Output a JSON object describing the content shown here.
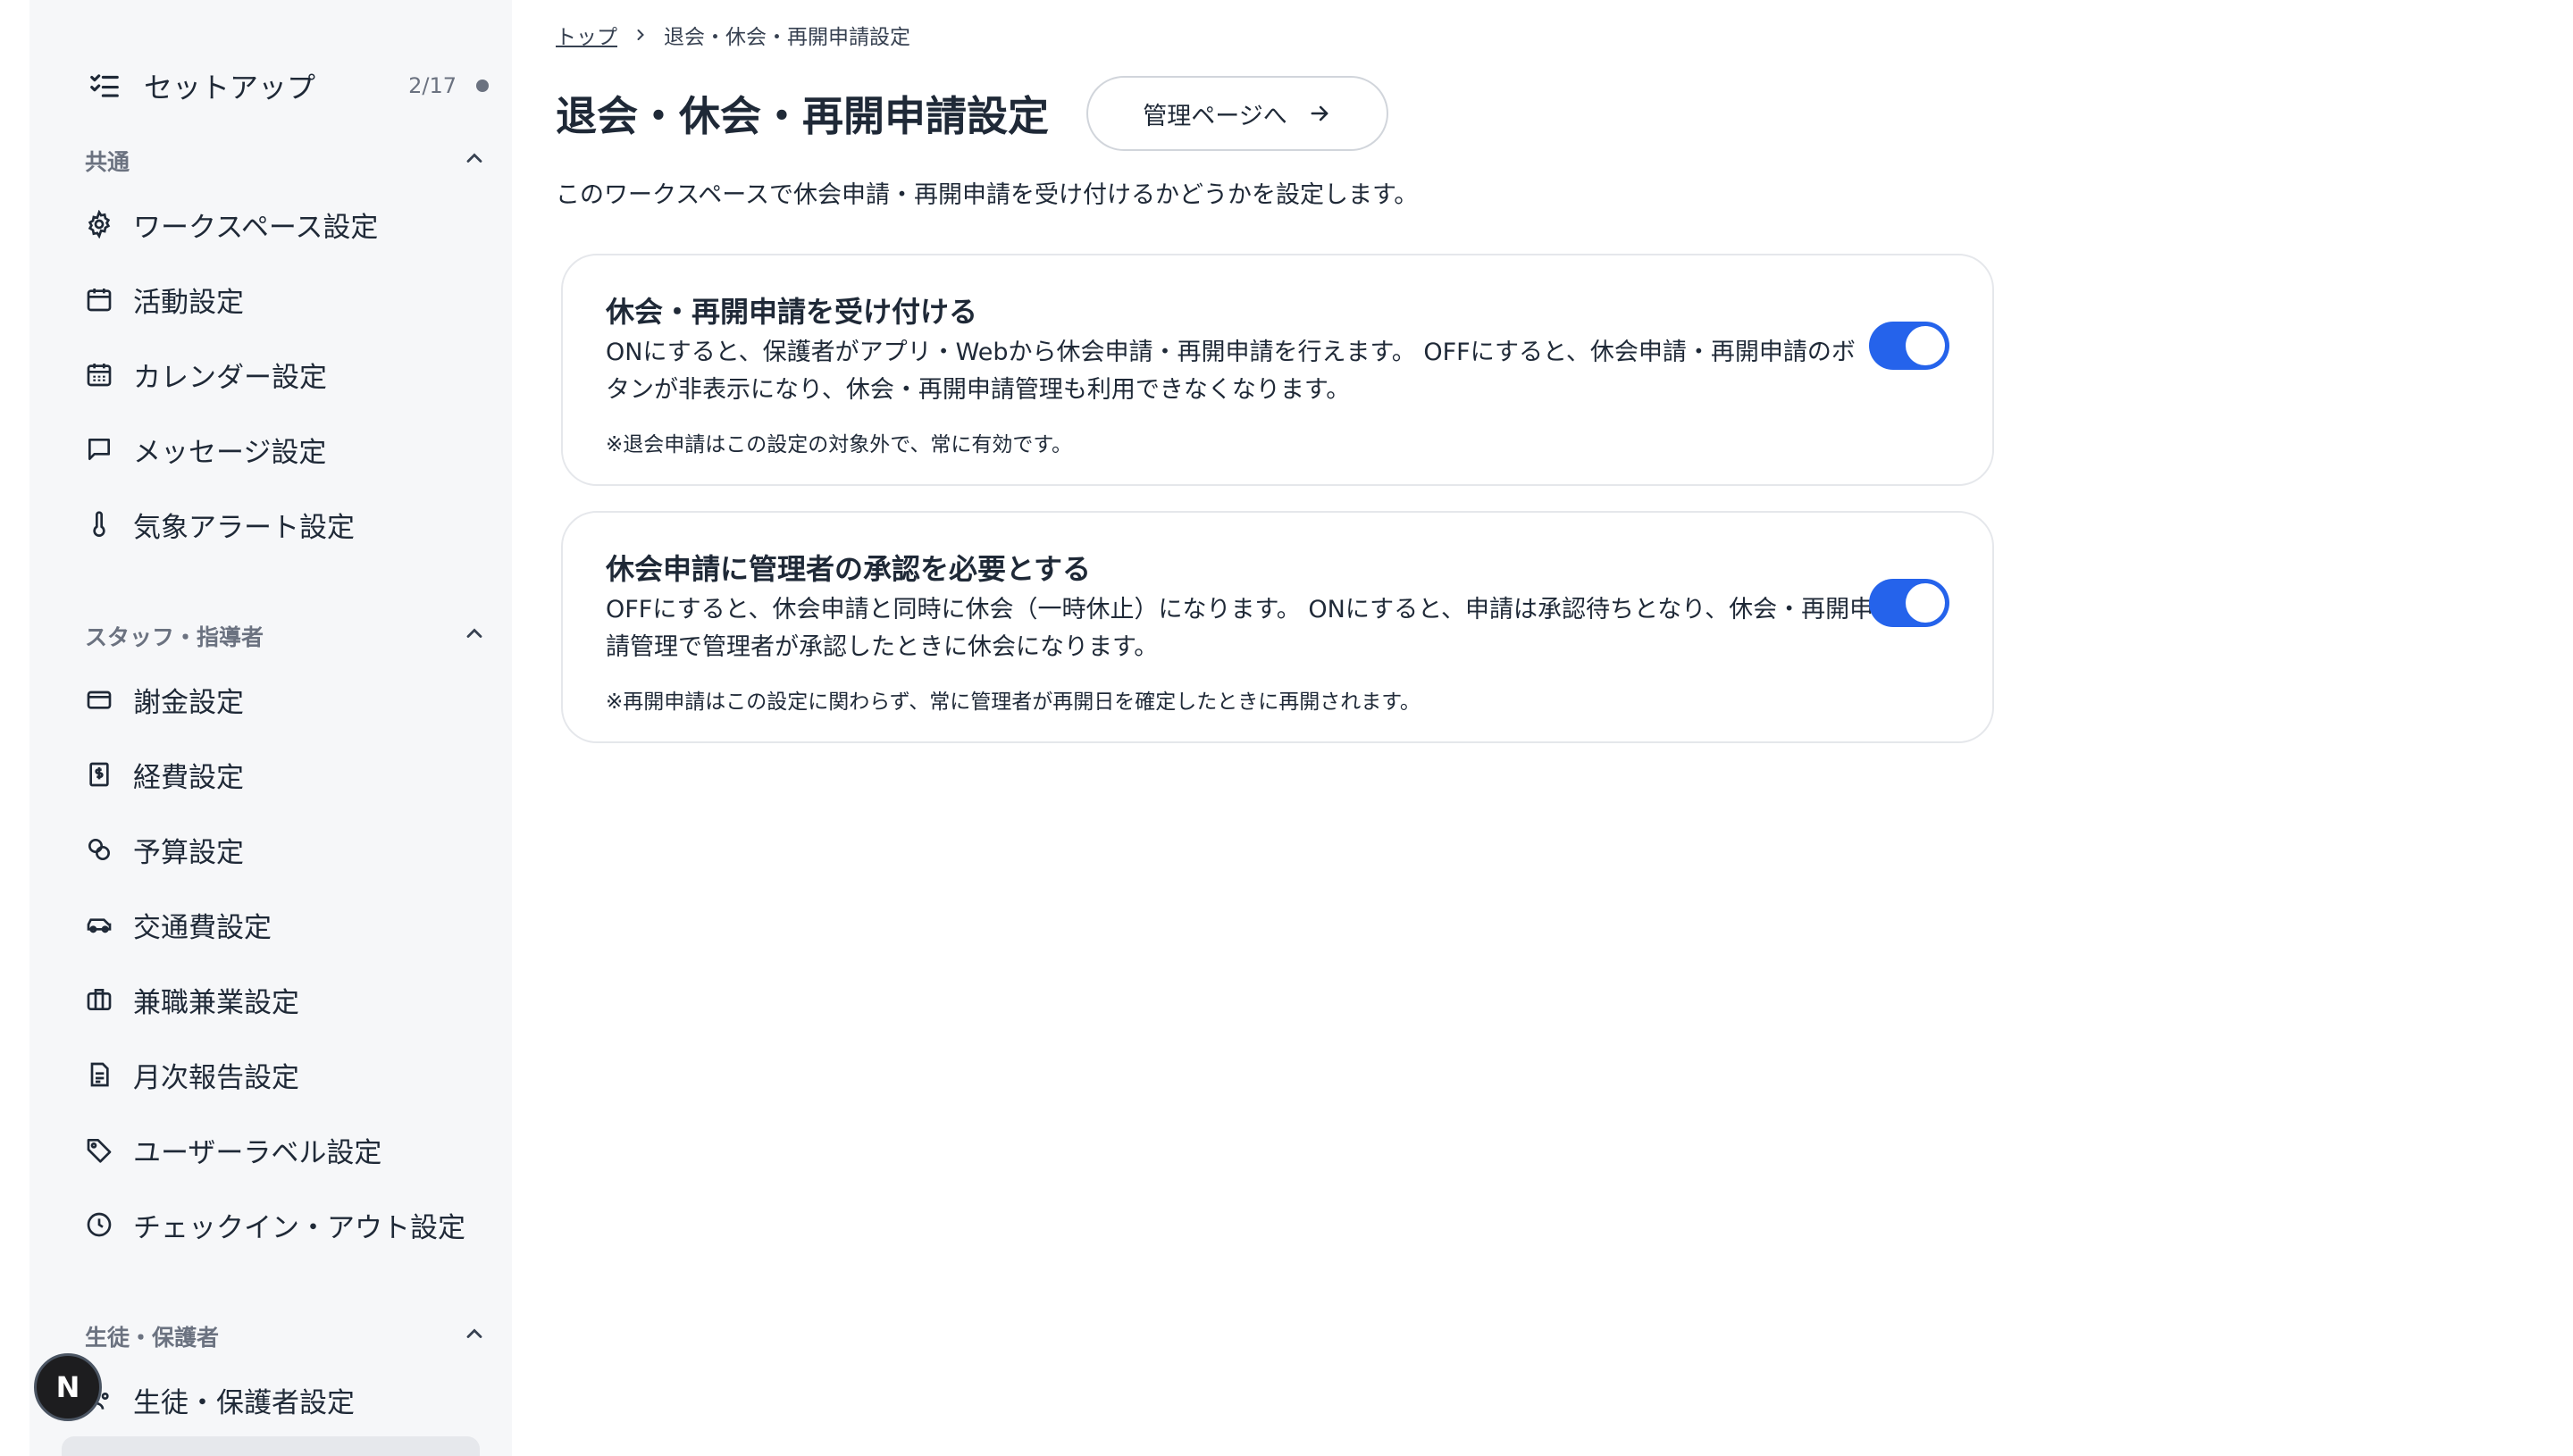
{
  "sidebar": {
    "setup": {
      "label": "セットアップ",
      "count": "2/17"
    },
    "sections": [
      {
        "title": "共通"
      },
      {
        "title": "スタッフ・指導者"
      },
      {
        "title": "生徒・保護者"
      }
    ],
    "common_items": [
      {
        "label": "ワークスペース設定",
        "icon": "gear-icon"
      },
      {
        "label": "活動設定",
        "icon": "calendar-icon"
      },
      {
        "label": "カレンダー設定",
        "icon": "calendar-grid-icon"
      },
      {
        "label": "メッセージ設定",
        "icon": "message-icon"
      },
      {
        "label": "気象アラート設定",
        "icon": "thermometer-icon"
      }
    ],
    "staff_items": [
      {
        "label": "謝金設定",
        "icon": "card-icon"
      },
      {
        "label": "経費設定",
        "icon": "receipt-icon"
      },
      {
        "label": "予算設定",
        "icon": "coins-icon"
      },
      {
        "label": "交通費設定",
        "icon": "car-icon"
      },
      {
        "label": "兼職兼業設定",
        "icon": "briefcase-icon"
      },
      {
        "label": "月次報告設定",
        "icon": "document-icon"
      },
      {
        "label": "ユーザーラベル設定",
        "icon": "tag-icon"
      },
      {
        "label": "チェックイン・アウト設定",
        "icon": "clock-icon"
      }
    ],
    "student_items": [
      {
        "label": "生徒・保護者設定",
        "icon": "users-icon"
      }
    ],
    "badge": "N"
  },
  "breadcrumb": {
    "home": "トップ",
    "current": "退会・休会・再開申請設定"
  },
  "page": {
    "title": "退会・休会・再開申請設定",
    "admin_button": "管理ページへ",
    "description": "このワークスペースで休会申請・再開申請を受け付けるかどうかを設定します。"
  },
  "cards": [
    {
      "title": "休会・再開申請を受け付ける",
      "body": "ONにすると、保護者がアプリ・Webから休会申請・再開申請を行えます。 OFFにすると、休会申請・再開申請のボタンが非表示になり、休会・再開申請管理も利用できなくなります。",
      "note": "※退会申請はこの設定の対象外で、常に有効です。",
      "enabled": true
    },
    {
      "title": "休会申請に管理者の承認を必要とする",
      "body": "OFFにすると、休会申請と同時に休会（一時休止）になります。 ONにすると、申請は承認待ちとなり、休会・再開申請管理で管理者が承認したときに休会になります。",
      "note": "※再開申請はこの設定に関わらず、常に管理者が再開日を確定したときに再開されます。",
      "enabled": true
    }
  ],
  "colors": {
    "accent": "#2563eb",
    "sidebar_bg": "#f6f7f9"
  }
}
